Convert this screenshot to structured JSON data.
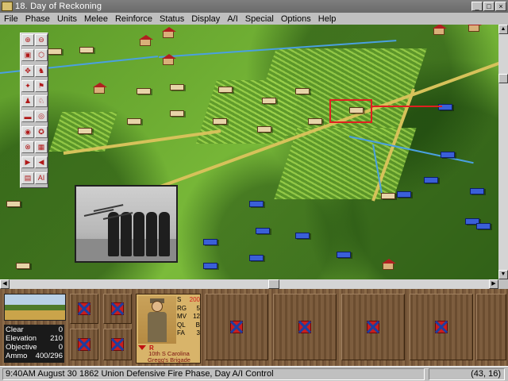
{
  "window": {
    "title": "18. Day of Reckoning",
    "buttons": [
      "_",
      "□",
      "×"
    ]
  },
  "menu": [
    "File",
    "Phase",
    "Units",
    "Melee",
    "Reinforce",
    "Status",
    "Display",
    "A/I",
    "Special",
    "Options",
    "Help"
  ],
  "toolbox": {
    "icons": [
      "zoom-in-icon",
      "zoom-out-icon",
      "unit-icon",
      "hex-icon",
      "move-icon",
      "leader-icon",
      "fire-icon",
      "flag-icon",
      "infantry-icon",
      "cavalry-icon",
      "artillery-icon",
      "binoculars-icon",
      "target-icon",
      "objective-icon",
      "compass-icon",
      "grid-icon",
      "next-icon",
      "prev-icon",
      "disk-icon",
      "ai-icon"
    ],
    "glyphs": [
      "⊕",
      "⊖",
      "▣",
      "⬡",
      "✥",
      "♞",
      "✦",
      "⚑",
      "♟",
      "♘",
      "▬",
      "◎",
      "◉",
      "✪",
      "⊗",
      "▦",
      "▶",
      "◀",
      "▤",
      "AI"
    ]
  },
  "terrain_info": {
    "rows": [
      {
        "label": "Clear",
        "value": "0"
      },
      {
        "label": "Elevation",
        "value": "210"
      },
      {
        "label": "Objective",
        "value": "0"
      },
      {
        "label": "Ammo",
        "value": "400/296"
      }
    ]
  },
  "leader": {
    "stats": [
      {
        "label": "S",
        "value": "200",
        "highlight": true
      },
      {
        "label": "RG",
        "value": "5"
      },
      {
        "label": "MV",
        "value": "12"
      },
      {
        "label": "QL",
        "value": "B"
      },
      {
        "label": "FA",
        "value": "3"
      }
    ],
    "rank": "R",
    "unit_name_1": "10th S Carolina",
    "unit_name_2": "Gregg's Brigade"
  },
  "status": {
    "text": "9:40AM August 30 1862 Union Defensive Fire Phase, Day A/I Control",
    "coords": "(43, 16)"
  }
}
